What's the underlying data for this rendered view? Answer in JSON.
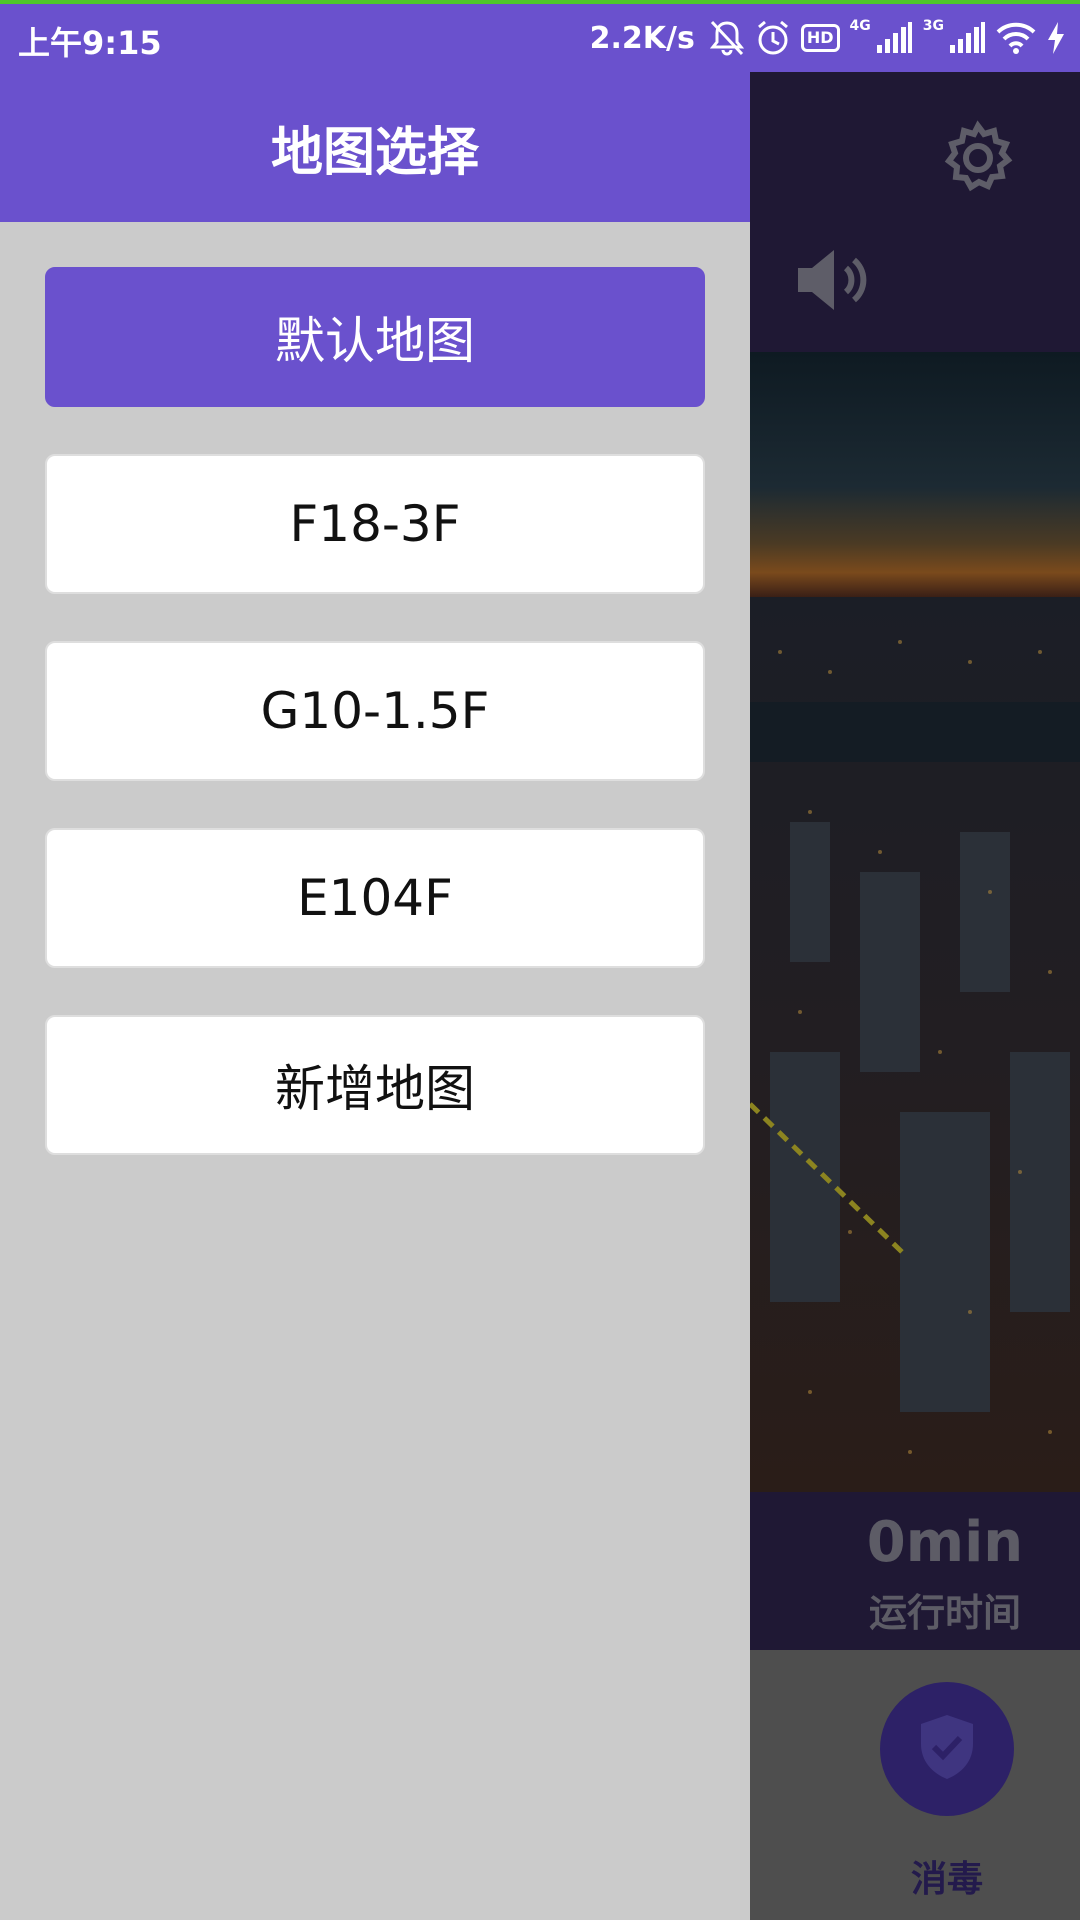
{
  "status_bar": {
    "time": "上午9:15",
    "net_speed": "2.2K/s",
    "hd_label": "HD",
    "net_type_1": "4G",
    "net_type_2": "3G",
    "icons": [
      "mute-bell-icon",
      "alarm-icon",
      "hd-icon",
      "signal-4g-icon",
      "signal-3g-icon",
      "wifi-icon",
      "charging-icon"
    ]
  },
  "drawer": {
    "title": "地图选择",
    "maps": [
      {
        "label": "默认地图",
        "selected": true
      },
      {
        "label": "F18-3F",
        "selected": false
      },
      {
        "label": "G10-1.5F",
        "selected": false
      },
      {
        "label": "E104F",
        "selected": false
      },
      {
        "label": "新增地图",
        "selected": false
      }
    ]
  },
  "main": {
    "runtime_value": "0min",
    "runtime_label": "运行时间",
    "disinfect_label": "消毒",
    "icons": [
      "settings-icon",
      "speaker-icon",
      "shield-check-icon"
    ]
  },
  "colors": {
    "accent": "#6a51cd",
    "status_line": "#4fc72a",
    "drawer_bg": "#cbcbcb"
  }
}
